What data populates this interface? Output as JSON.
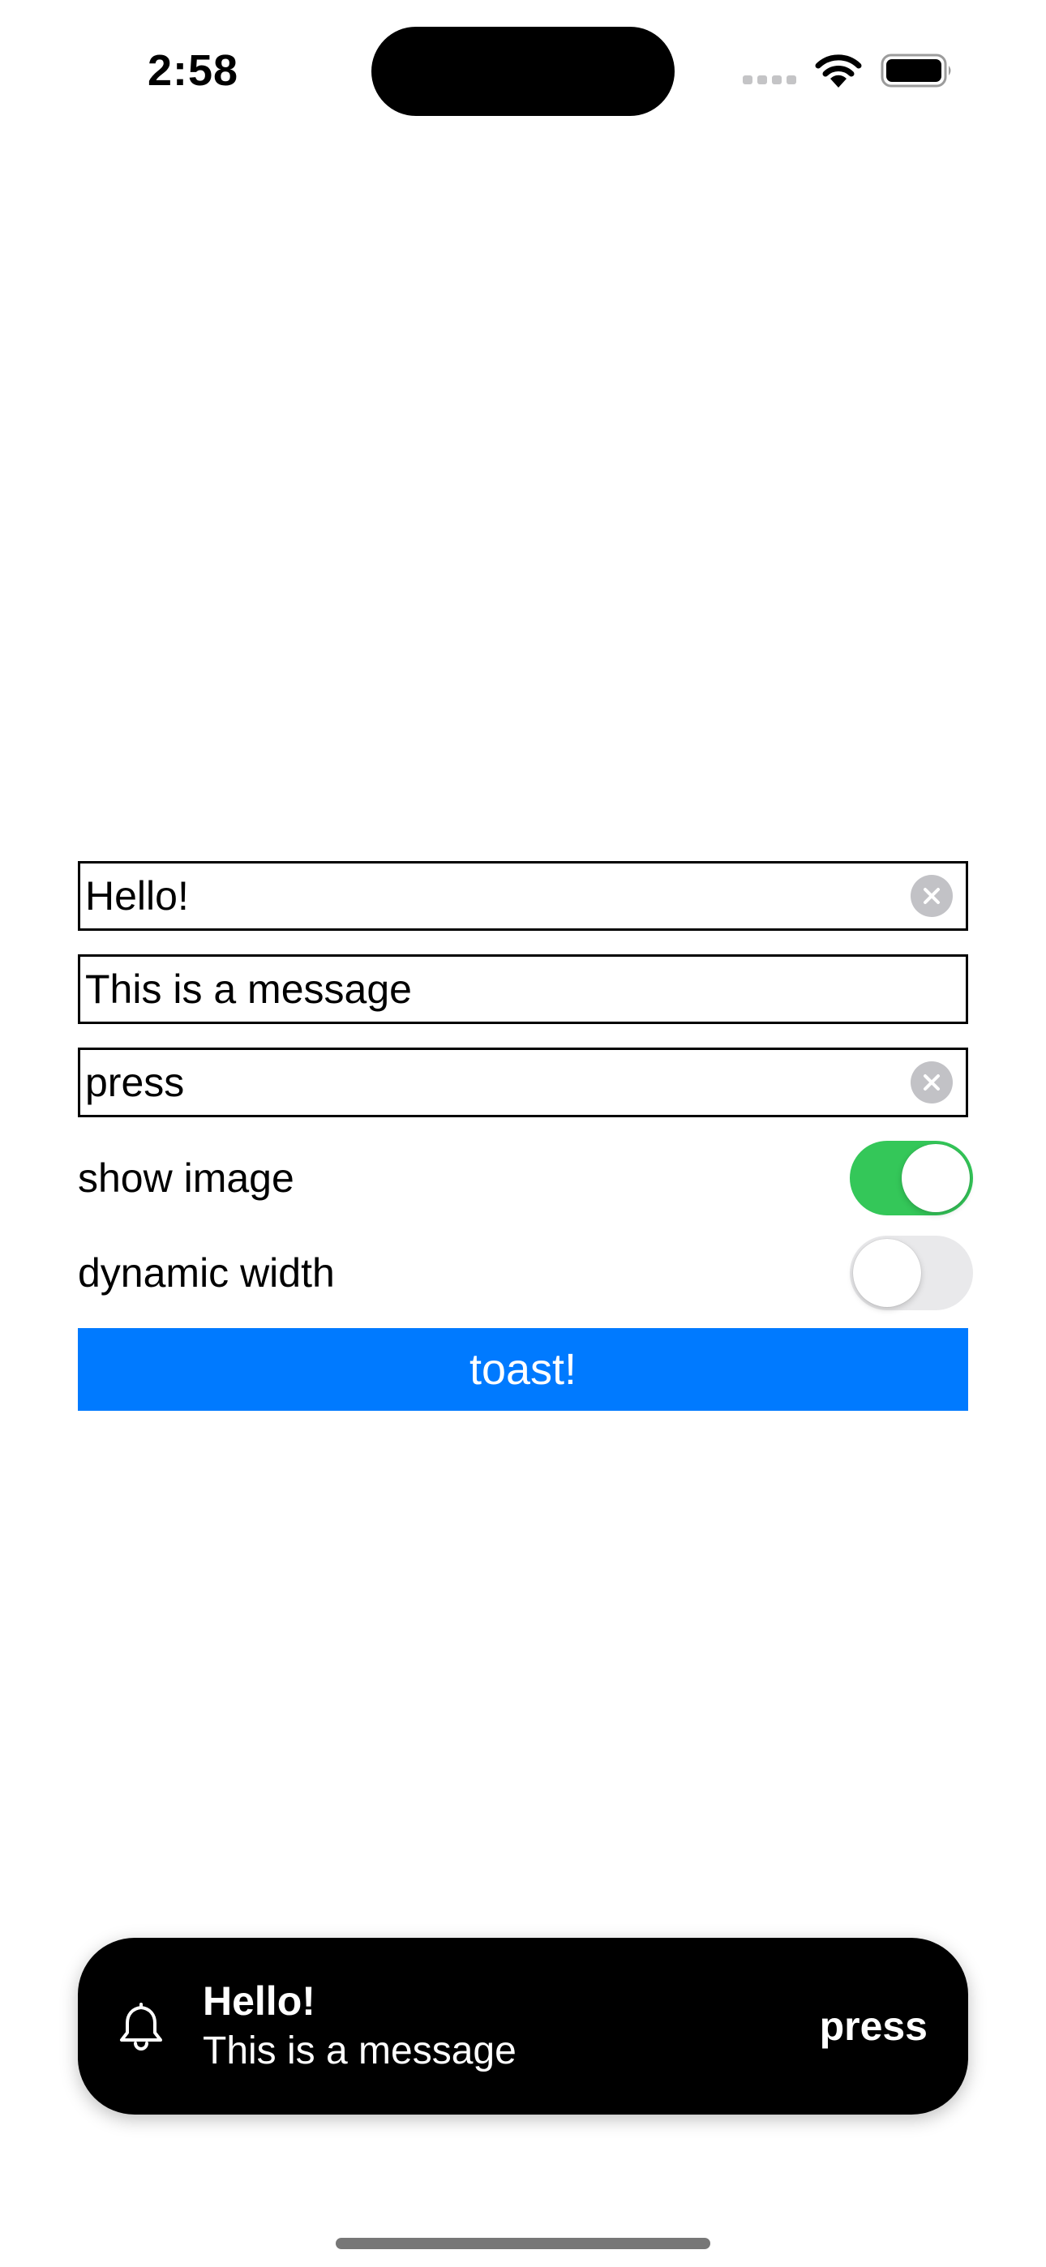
{
  "status_bar": {
    "time": "2:58"
  },
  "form": {
    "title_field": {
      "value": "Hello!"
    },
    "message_field": {
      "value": "This is a message"
    },
    "action_field": {
      "value": "press"
    },
    "show_image": {
      "label": "show image",
      "checked": true
    },
    "dynamic_width": {
      "label": "dynamic width",
      "checked": false
    },
    "toast_button_label": "toast!"
  },
  "toast": {
    "icon": "bell-icon",
    "title": "Hello!",
    "message": "This is a message",
    "action_label": "press"
  },
  "colors": {
    "accent": "#007aff",
    "switch_on": "#34c759",
    "switch_off": "#e9e9eb",
    "toast_bg": "#000000"
  }
}
